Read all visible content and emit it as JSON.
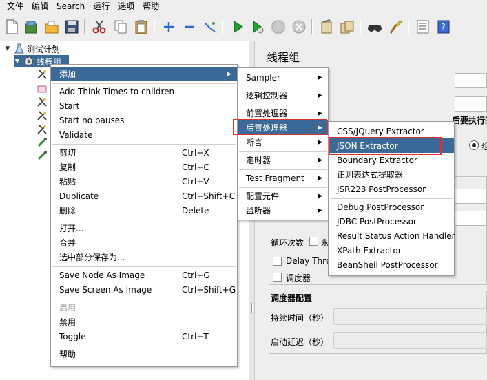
{
  "menubar": [
    "文件",
    "编辑",
    "Search",
    "运行",
    "选项",
    "帮助"
  ],
  "toolbar": [
    {
      "icon": "new-icon"
    },
    {
      "icon": "templates-icon"
    },
    {
      "icon": "open-icon"
    },
    {
      "icon": "save-icon"
    },
    {
      "icon": "cut-icon"
    },
    {
      "icon": "copy-icon"
    },
    {
      "icon": "paste-icon"
    },
    {
      "icon": "expand-icon"
    },
    {
      "icon": "collapse-icon"
    },
    {
      "icon": "toggle-icon"
    },
    {
      "icon": "start-icon"
    },
    {
      "icon": "start-no-pauses-icon"
    },
    {
      "icon": "stop-icon"
    },
    {
      "icon": "shutdown-icon"
    },
    {
      "icon": "clear-icon"
    },
    {
      "icon": "clear-all-icon"
    },
    {
      "icon": "search-icon"
    },
    {
      "icon": "reset-search-icon"
    },
    {
      "icon": "function-helper-icon"
    },
    {
      "icon": "help-icon"
    }
  ],
  "tree": {
    "root": "测试计划",
    "selected": "线程组"
  },
  "right_panel": {
    "title": "线程组",
    "action_label_partial": "后要执行的动作",
    "loop_label": "循环次数",
    "loop_partial": "永",
    "delay_label": "Delay Thre",
    "scheduler_checkbox": "调度器",
    "scheduler_config_title": "调度器配置",
    "duration_label": "持续时间（秒）",
    "startup_delay_label": "启动延迟（秒）",
    "radio_partial": "组"
  },
  "context_menu": {
    "items": [
      {
        "label": "添加",
        "accel": "",
        "submenu": true
      },
      {
        "label": "Add Think Times to children",
        "accel": ""
      },
      {
        "label": "Start",
        "accel": ""
      },
      {
        "label": "Start no pauses",
        "accel": ""
      },
      {
        "label": "Validate",
        "accel": ""
      },
      {
        "label": "剪切",
        "accel": "Ctrl+X"
      },
      {
        "label": "复制",
        "accel": "Ctrl+C"
      },
      {
        "label": "粘贴",
        "accel": "Ctrl+V"
      },
      {
        "label": "Duplicate",
        "accel": "Ctrl+Shift+C"
      },
      {
        "label": "删除",
        "accel": "Delete"
      },
      {
        "label": "打开...",
        "accel": ""
      },
      {
        "label": "合并",
        "accel": ""
      },
      {
        "label": "选中部分保存为...",
        "accel": ""
      },
      {
        "label": "Save Node As Image",
        "accel": "Ctrl+G"
      },
      {
        "label": "Save Screen As Image",
        "accel": "Ctrl+Shift+G"
      },
      {
        "label": "启用",
        "accel": ""
      },
      {
        "label": "禁用",
        "accel": ""
      },
      {
        "label": "Toggle",
        "accel": "Ctrl+T"
      },
      {
        "label": "帮助",
        "accel": ""
      }
    ]
  },
  "add_submenu": {
    "items": [
      "Sampler",
      "逻辑控制器",
      "前置处理器",
      "后置处理器",
      "断言",
      "定时器",
      "Test Fragment",
      "配置元件",
      "监听器"
    ]
  },
  "postprocessor_submenu": {
    "items": [
      "CSS/JQuery Extractor",
      "JSON Extractor",
      "Boundary Extractor",
      "正则表达式提取器",
      "JSR223 PostProcessor",
      "Debug PostProcessor",
      "JDBC PostProcessor",
      "Result Status Action Handler",
      "XPath Extractor",
      "BeanShell PostProcessor"
    ]
  },
  "colors": {
    "highlight": "#3b6a98",
    "annotation": "#e0302f"
  }
}
